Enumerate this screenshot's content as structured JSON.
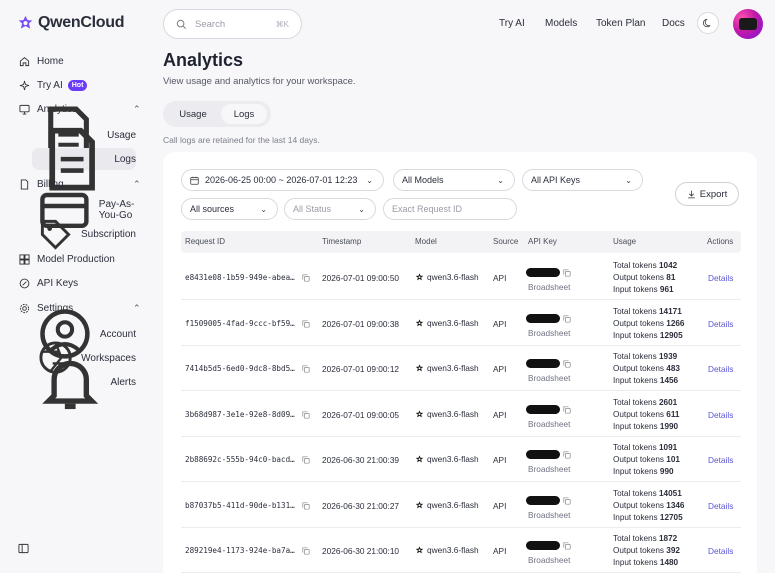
{
  "brand": {
    "name": "QwenCloud"
  },
  "sidebar": {
    "items": [
      {
        "label": "Home"
      },
      {
        "label": "Try AI",
        "badge": "Hot"
      },
      {
        "label": "Analytics",
        "children": [
          {
            "label": "Usage"
          },
          {
            "label": "Logs",
            "active": true
          }
        ]
      },
      {
        "label": "Billing",
        "children": [
          {
            "label": "Pay-As-You-Go"
          },
          {
            "label": "Subscription"
          }
        ]
      },
      {
        "label": "Model Production"
      },
      {
        "label": "API Keys"
      },
      {
        "label": "Settings",
        "children": [
          {
            "label": "Account"
          },
          {
            "label": "Workspaces"
          },
          {
            "label": "Alerts"
          }
        ]
      }
    ]
  },
  "header": {
    "search_placeholder": "Search",
    "search_shortcut": "⌘K",
    "nav": [
      "Try AI",
      "Models",
      "Token Plan",
      "Docs"
    ]
  },
  "page": {
    "title": "Analytics",
    "subtitle": "View usage and analytics for your workspace.",
    "tabs": [
      {
        "label": "Usage"
      },
      {
        "label": "Logs",
        "active": true
      }
    ],
    "retention_note": "Call logs are retained for the last 14 days."
  },
  "filters": {
    "date_range": "2026-06-25 00:00 ~ 2026-07-01 12:23",
    "models": "All Models",
    "api_keys": "All API Keys",
    "sources": "All sources",
    "status": "All Status",
    "request_id_placeholder": "Exact Request ID",
    "export_label": "Export"
  },
  "table": {
    "columns": [
      "Request ID",
      "Timestamp",
      "Model",
      "Source",
      "API Key",
      "Usage",
      "Actions"
    ],
    "usage_labels": {
      "total": "Total tokens",
      "output": "Output tokens",
      "input": "Input tokens"
    },
    "rows": [
      {
        "request_id": "e8431e08-1b59-949e-abea…",
        "timestamp": "2026-07-01 09:00:50",
        "model": "qwen3.6-flash",
        "source": "API",
        "api_key_name": "Broadsheet",
        "total": "1042",
        "output": "81",
        "input": "961",
        "action": "Details"
      },
      {
        "request_id": "f1509005-4fad-9ccc-bf59…",
        "timestamp": "2026-07-01 09:00:38",
        "model": "qwen3.6-flash",
        "source": "API",
        "api_key_name": "Broadsheet",
        "total": "14171",
        "output": "1266",
        "input": "12905",
        "action": "Details"
      },
      {
        "request_id": "7414b5d5-6ed0-9dc8-8bd5…",
        "timestamp": "2026-07-01 09:00:12",
        "model": "qwen3.6-flash",
        "source": "API",
        "api_key_name": "Broadsheet",
        "total": "1939",
        "output": "483",
        "input": "1456",
        "action": "Details"
      },
      {
        "request_id": "3b68d987-3e1e-92e8-8d09…",
        "timestamp": "2026-07-01 09:00:05",
        "model": "qwen3.6-flash",
        "source": "API",
        "api_key_name": "Broadsheet",
        "total": "2601",
        "output": "611",
        "input": "1990",
        "action": "Details"
      },
      {
        "request_id": "2b88692c-555b-94c0-bacd…",
        "timestamp": "2026-06-30 21:00:39",
        "model": "qwen3.6-flash",
        "source": "API",
        "api_key_name": "Broadsheet",
        "total": "1091",
        "output": "101",
        "input": "990",
        "action": "Details"
      },
      {
        "request_id": "b87037b5-411d-90de-b131…",
        "timestamp": "2026-06-30 21:00:27",
        "model": "qwen3.6-flash",
        "source": "API",
        "api_key_name": "Broadsheet",
        "total": "14051",
        "output": "1346",
        "input": "12705",
        "action": "Details"
      },
      {
        "request_id": "289219e4-1173-924e-ba7a…",
        "timestamp": "2026-06-30 21:00:10",
        "model": "qwen3.6-flash",
        "source": "API",
        "api_key_name": "Broadsheet",
        "total": "1872",
        "output": "392",
        "input": "1480",
        "action": "Details"
      }
    ]
  },
  "colors": {
    "accent": "#6b3cf5",
    "link": "#5b56d6",
    "avatar": "#c21aa8"
  }
}
